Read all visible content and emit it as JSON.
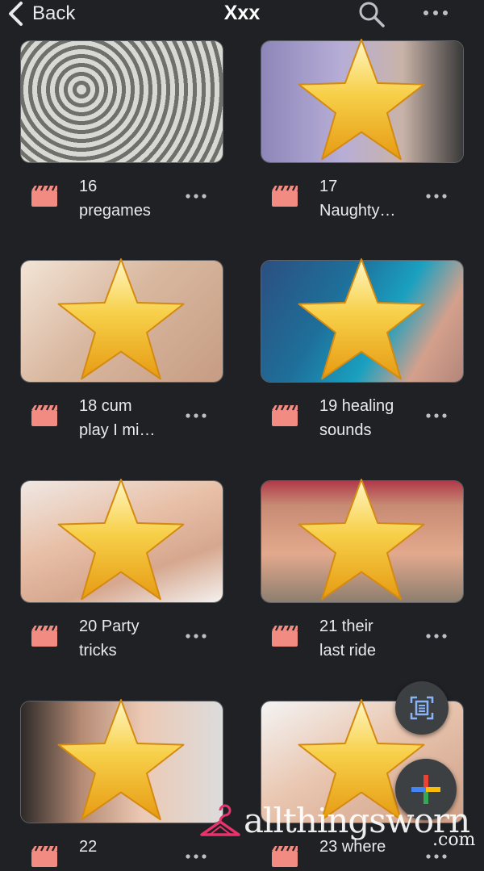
{
  "header": {
    "back_label": "Back",
    "title": "Xxx",
    "search_icon": "search-icon",
    "more_icon": "more-horizontal-icon"
  },
  "files": [
    {
      "line1": "16",
      "line2": "pregames",
      "censored": false,
      "type_icon": "video-file-icon"
    },
    {
      "line1": "17",
      "line2": "Naughty…",
      "censored": true,
      "type_icon": "video-file-icon"
    },
    {
      "line1": "18 cum",
      "line2": "play I mi…",
      "censored": true,
      "type_icon": "video-file-icon"
    },
    {
      "line1": "19 healing",
      "line2": "sounds",
      "censored": true,
      "type_icon": "video-file-icon"
    },
    {
      "line1": "20 Party",
      "line2": "tricks",
      "censored": true,
      "type_icon": "video-file-icon"
    },
    {
      "line1": "21 their",
      "line2": "last ride",
      "censored": true,
      "type_icon": "video-file-icon"
    },
    {
      "line1": "22",
      "line2": "",
      "censored": true,
      "type_icon": "video-file-icon"
    },
    {
      "line1": "23 where",
      "line2": "",
      "censored": true,
      "type_icon": "video-file-icon"
    }
  ],
  "fabs": {
    "scan_icon": "document-scan-icon",
    "new_icon": "plus-icon"
  },
  "watermark": {
    "text": "allthingsworn",
    "suffix": ".com",
    "logo_icon": "hanger-logo-icon"
  },
  "colors": {
    "background": "#202124",
    "file_icon": "#f28b82",
    "text": "#e8eaed",
    "watermark_pink": "#e8336d"
  }
}
